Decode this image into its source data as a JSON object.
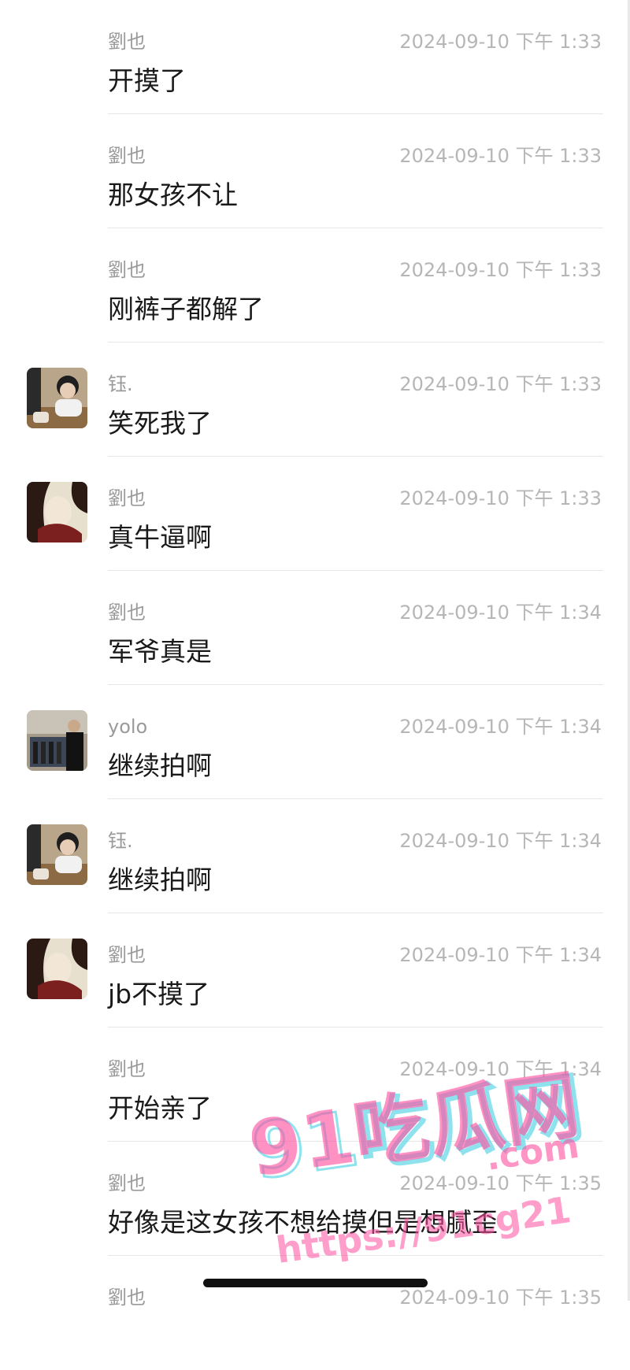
{
  "messages": [
    {
      "sender": "劉也",
      "time": "2024-09-10 下午 1:33",
      "text": "开摸了",
      "avatar": null
    },
    {
      "sender": "劉也",
      "time": "2024-09-10 下午 1:33",
      "text": "那女孩不让",
      "avatar": null
    },
    {
      "sender": "劉也",
      "time": "2024-09-10 下午 1:33",
      "text": "刚裤子都解了",
      "avatar": null
    },
    {
      "sender": "钰.",
      "time": "2024-09-10 下午 1:33",
      "text": "笑死我了",
      "avatar": "girl-photo-avatar"
    },
    {
      "sender": "劉也",
      "time": "2024-09-10 下午 1:33",
      "text": "真牛逼啊",
      "avatar": "painting-avatar"
    },
    {
      "sender": "劉也",
      "time": "2024-09-10 下午 1:34",
      "text": "军爷真是",
      "avatar": null
    },
    {
      "sender": "yolo",
      "time": "2024-09-10 下午 1:34",
      "text": "继续拍啊",
      "avatar": "group-photo-avatar"
    },
    {
      "sender": "钰.",
      "time": "2024-09-10 下午 1:34",
      "text": "继续拍啊",
      "avatar": "girl-photo-avatar"
    },
    {
      "sender": "劉也",
      "time": "2024-09-10 下午 1:34",
      "text": "jb不摸了",
      "avatar": "painting-avatar"
    },
    {
      "sender": "劉也",
      "time": "2024-09-10 下午 1:34",
      "text": "开始亲了",
      "avatar": null
    },
    {
      "sender": "劉也",
      "time": "2024-09-10 下午 1:35",
      "text": "好像是这女孩不想给摸但是想腻歪",
      "avatar": null
    },
    {
      "sender": "劉也",
      "time": "2024-09-10 下午 1:35",
      "text": "",
      "avatar": null
    }
  ],
  "watermark": {
    "brand": "91吃瓜网",
    "domain": ".com",
    "url": "https://91cg21"
  },
  "colors": {
    "background": "#ffffff",
    "text": "#1a1a1a",
    "sender": "#9a9a9a",
    "time": "#b6b6b6",
    "divider": "#e6e6e6",
    "watermark_pink": "#ff4fa0",
    "watermark_cyan": "#5fd6e8"
  }
}
